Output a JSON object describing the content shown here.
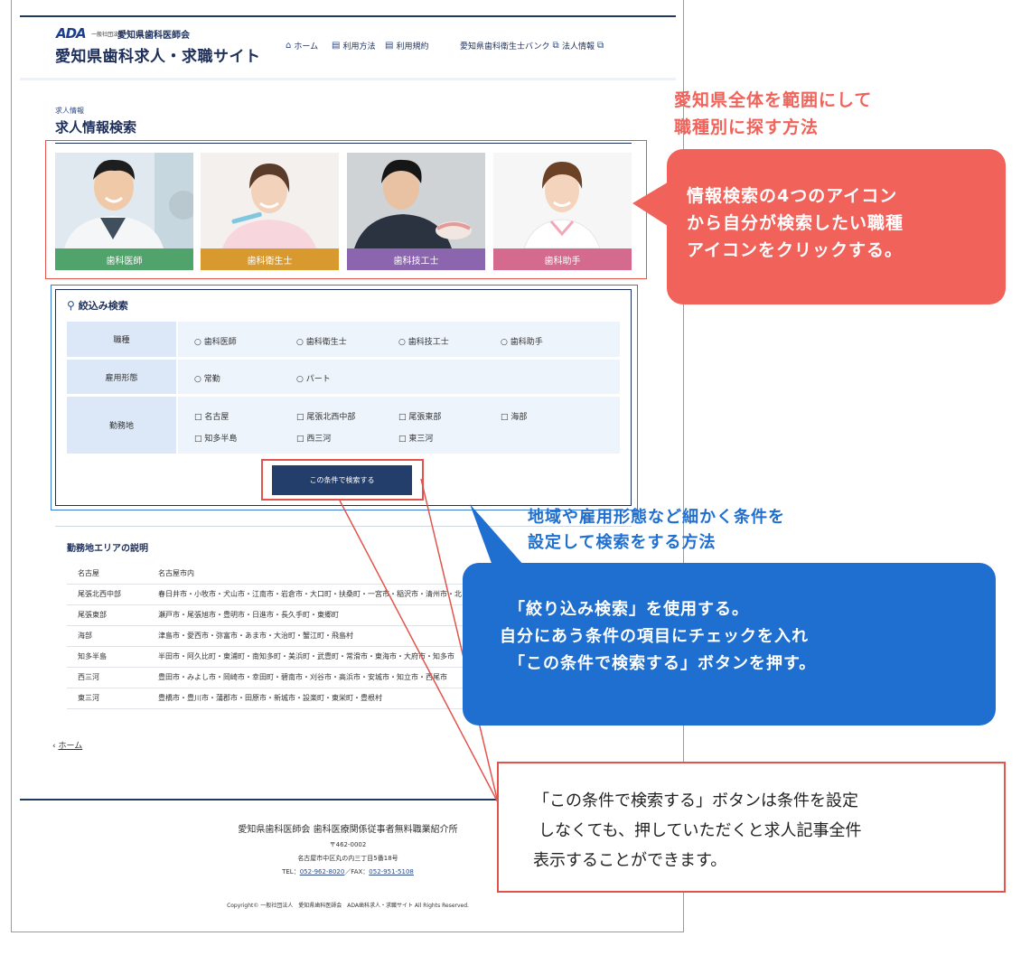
{
  "header": {
    "logo_ada": "ADA",
    "logo_org_small": "一般社団法人",
    "logo_org": "愛知県歯科医師会",
    "site_title": "愛知県歯科求人・求職サイト",
    "nav": [
      {
        "label": "ホーム",
        "icon": "home-icon"
      },
      {
        "label": "利用方法",
        "icon": "document-icon"
      },
      {
        "label": "利用規約",
        "icon": "document-icon"
      },
      {
        "label": "愛知県歯科衛生士バンク",
        "icon": "external-link-icon"
      },
      {
        "label": "法人情報",
        "icon": "external-link-icon"
      }
    ]
  },
  "page": {
    "breadcrumb_small": "求人情報",
    "title": "求人情報検索"
  },
  "jobs": [
    {
      "label": "歯科医師",
      "color": "#4fa36b"
    },
    {
      "label": "歯科衛生士",
      "color": "#d89a2e"
    },
    {
      "label": "歯科技工士",
      "color": "#8b65ad"
    },
    {
      "label": "歯科助手",
      "color": "#d46b8e"
    }
  ],
  "search": {
    "heading": "絞込み検索",
    "job_type": {
      "label": "職種",
      "options": [
        "○ 歯科医師",
        "○ 歯科衛生士",
        "○ 歯科技工士",
        "○ 歯科助手"
      ]
    },
    "employment": {
      "label": "雇用形態",
      "options": [
        "○ 常勤",
        "○ パート"
      ]
    },
    "location": {
      "label": "勤務地",
      "options": [
        "□ 名古屋",
        "□ 尾張北西中部",
        "□ 尾張東部",
        "□ 海部",
        "□ 知多半島",
        "□ 西三河",
        "□ 東三河"
      ]
    },
    "button_label": "この条件で検索する"
  },
  "areas": {
    "title": "勤務地エリアの説明",
    "rows": [
      {
        "name": "名古屋",
        "cities": "名古屋市内"
      },
      {
        "name": "尾張北西中部",
        "cities": "春日井市・小牧市・犬山市・江南市・岩倉市・大口町・扶桑町・一宮市・稲沢市・清州市・北"
      },
      {
        "name": "尾張東部",
        "cities": "瀬戸市・尾張旭市・豊明市・日進市・長久手町・東郷町"
      },
      {
        "name": "海部",
        "cities": "津島市・愛西市・弥富市・あま市・大治町・蟹江町・飛島村"
      },
      {
        "name": "知多半島",
        "cities": "半田市・阿久比町・東浦町・南知多町・美浜町・武豊町・常滑市・東海市・大府市・知多市"
      },
      {
        "name": "西三河",
        "cities": "豊田市・みよし市・岡崎市・幸田町・碧南市・刈谷市・高浜市・安城市・知立市・西尾市"
      },
      {
        "name": "東三河",
        "cities": "豊橋市・豊川市・蒲郡市・田原市・新城市・設楽町・東栄町・豊根村"
      }
    ]
  },
  "back_link": {
    "chevron": "‹",
    "label": "ホーム"
  },
  "footer": {
    "org": "愛知県歯科医師会 歯科医療関係従事者無料職業紹介所",
    "postal": "〒462-0002",
    "address": "名古屋市中区丸の内三丁目5番18号",
    "tel_label": "TEL：",
    "tel": "052-962-8020",
    "fax_label": "／FAX：",
    "fax": "052-951-5108",
    "copyright": "Copyright© 一般社団法人　愛知県歯科医師会　ADA歯科求人・求職サイト All Rights Reserved."
  },
  "annotations": {
    "red_title_1": "愛知県全体を範囲にして",
    "red_title_2": "職種別に探す方法",
    "red_bubble_1": "情報検索の4つのアイコン",
    "red_bubble_2": "から自分が検索したい職種",
    "red_bubble_3": "アイコンをクリックする。",
    "blue_title_1": "地域や雇用形態など細かく条件を",
    "blue_title_2": "設定して検索をする方法",
    "blue_bubble_1": "「絞り込み検索」を使用する。",
    "blue_bubble_2": "自分にあう条件の項目にチェックを入れ",
    "blue_bubble_3": "「この条件で検索する」ボタンを押す。",
    "note_1": "「この条件で検索する」ボタンは条件を設定",
    "note_2": "しなくても、押していただくと求人記事全件",
    "note_3": "表示することができます。"
  },
  "colors": {
    "navy": "#1d2f5a",
    "annotation_red": "#f0625a",
    "annotation_blue": "#1f6fd0"
  }
}
